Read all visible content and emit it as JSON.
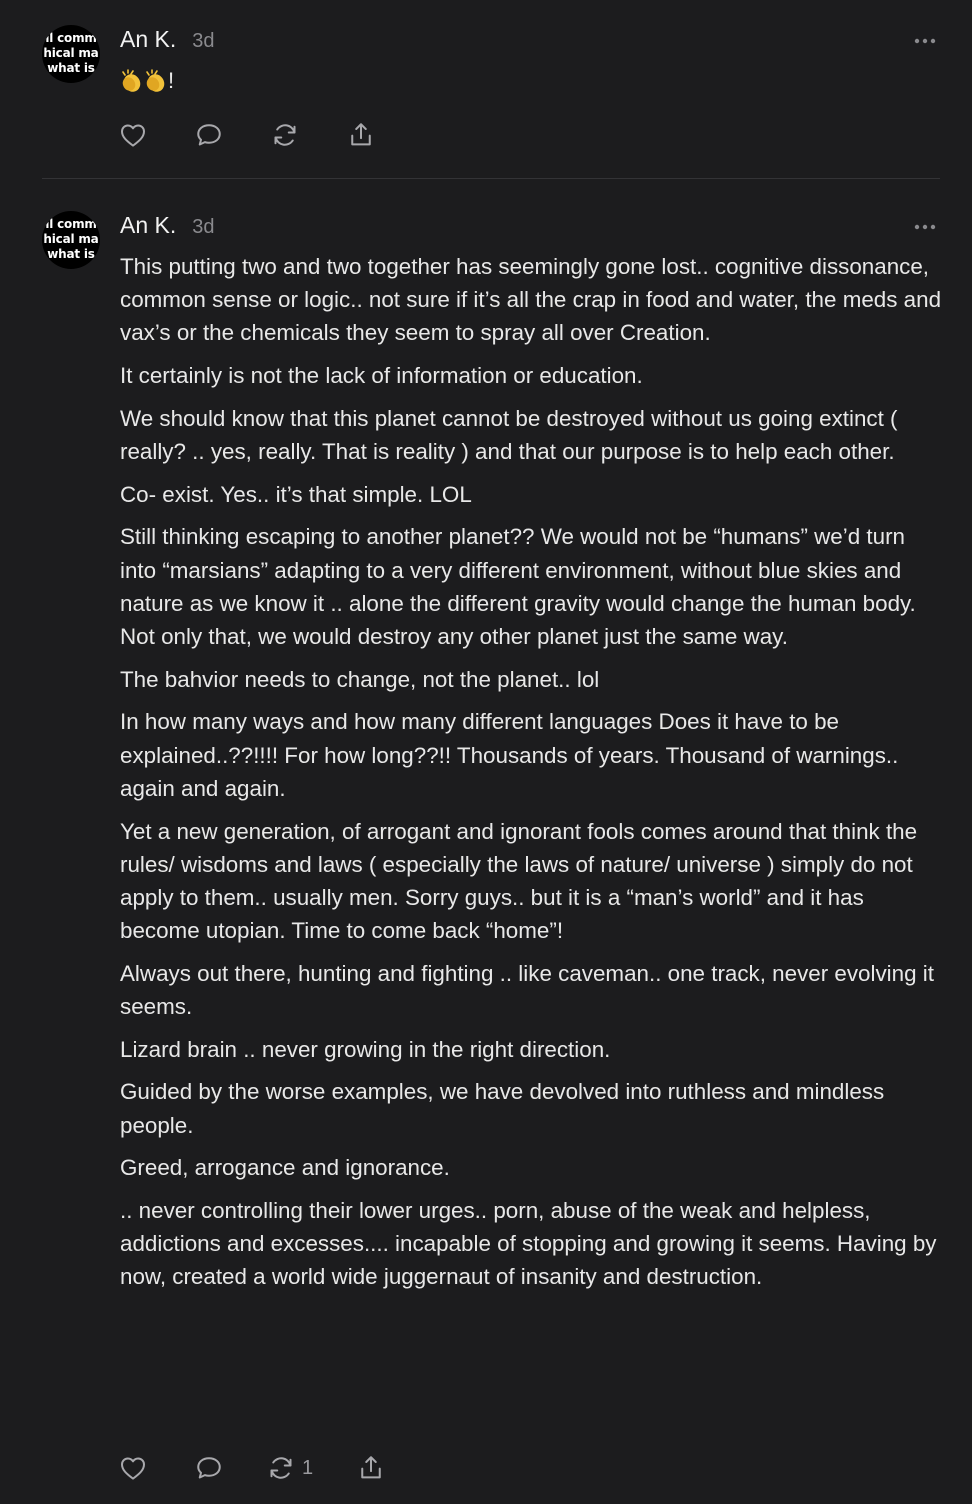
{
  "colors": {
    "background": "#1c1c1e",
    "text": "#e8e8e8",
    "muted": "#8a8a8e",
    "divider": "#333336",
    "icon": "#a8a8ac",
    "clap": "#f2c23a"
  },
  "comments": [
    {
      "avatar": {
        "lines": [
          "ll comm",
          "hical ma",
          "what is"
        ]
      },
      "author": "An K.",
      "time": "3d",
      "emoji_icons": [
        "clapping-hands-icon",
        "clapping-hands-icon"
      ],
      "emoji_suffix": "!",
      "actions": {
        "like_icon": "heart-icon",
        "reply_icon": "comment-icon",
        "restack_icon": "restack-icon",
        "share_icon": "share-icon",
        "restack_count": ""
      }
    },
    {
      "avatar": {
        "lines": [
          "ll comm",
          "hical ma",
          "what is"
        ]
      },
      "author": "An K.",
      "time": "3d",
      "paragraphs": [
        "This putting two and two together has seemingly gone lost.. cognitive dissonance, common sense or logic.. not sure if it’s all the crap in food and water, the meds and vax’s or the chemicals they seem to spray all over Creation.",
        "It certainly is not the lack of information or education.",
        "We should know that this planet cannot be destroyed without us going extinct ( really? .. yes, really. That is reality ) and that our purpose is to help each other.",
        "Co- exist. Yes.. it’s that simple. LOL",
        "Still thinking escaping to another planet?? We would not be “humans” we’d turn into “marsians” adapting to a very different environment, without blue skies and nature as we know it .. alone the different gravity would change the human body. Not only that, we would destroy any other planet just the same way.",
        "The bahvior needs to change, not the planet.. lol",
        "In how many ways and how many different languages Does it have to be explained..??!!!! For how long??!! Thousands of years. Thousand of warnings.. again and again.",
        "Yet a new generation, of arrogant and ignorant fools comes around that think the rules/ wisdoms and laws ( especially the laws of nature/ universe ) simply do not apply to them.. usually men. Sorry guys.. but it is a “man’s world” and it has become utopian. Time to come back “home”!",
        "Always out there, hunting and fighting .. like caveman.. one track, never evolving it seems.",
        "Lizard brain .. never growing in the right direction.",
        "Guided by the worse examples, we have devolved into ruthless and mindless people.",
        "Greed, arrogance and ignorance.",
        ".. never controlling their lower urges.. porn, abuse of the weak and helpless, addictions and excesses.... incapable of stopping and growing it seems. Having by now, created a world wide juggernaut of insanity and destruction."
      ],
      "actions": {
        "like_icon": "heart-icon",
        "reply_icon": "comment-icon",
        "restack_icon": "restack-icon",
        "share_icon": "share-icon",
        "restack_count": "1"
      }
    }
  ]
}
